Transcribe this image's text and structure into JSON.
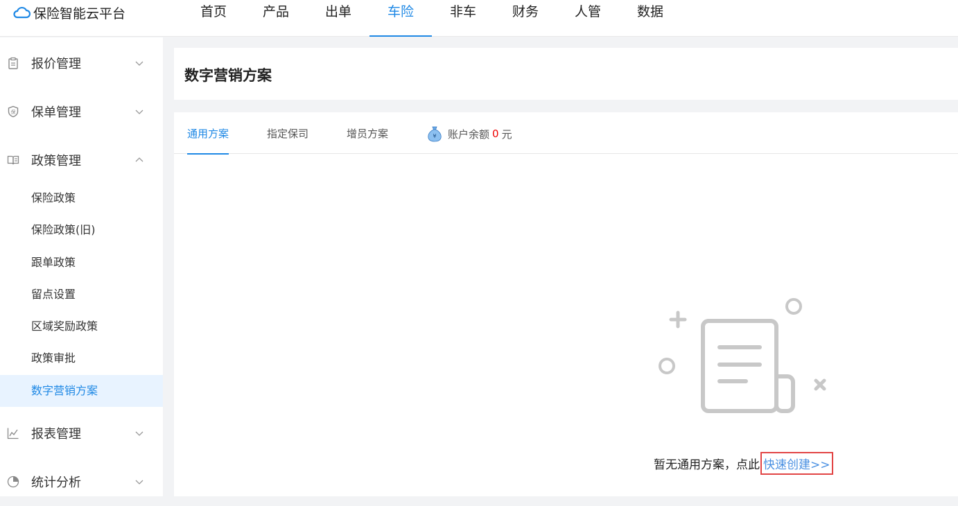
{
  "app": {
    "title": "保险智能云平台",
    "logo_icon": "cloud-icon"
  },
  "nav": {
    "items": [
      {
        "label": "首页",
        "active": false
      },
      {
        "label": "产品",
        "active": false
      },
      {
        "label": "出单",
        "active": false
      },
      {
        "label": "车险",
        "active": true
      },
      {
        "label": "非车",
        "active": false
      },
      {
        "label": "财务",
        "active": false
      },
      {
        "label": "人管",
        "active": false
      },
      {
        "label": "数据",
        "active": false
      }
    ]
  },
  "sidebar": {
    "groups": [
      {
        "label": "报价管理",
        "icon": "clipboard-icon",
        "expanded": false
      },
      {
        "label": "保单管理",
        "icon": "shield-icon",
        "expanded": false
      },
      {
        "label": "政策管理",
        "icon": "book-icon",
        "expanded": true
      },
      {
        "label": "报表管理",
        "icon": "line-chart-icon",
        "expanded": false
      },
      {
        "label": "统计分析",
        "icon": "pie-chart-icon",
        "expanded": false
      }
    ],
    "sub_items": [
      {
        "label": "保险政策",
        "active": false
      },
      {
        "label": "保险政策(旧)",
        "active": false
      },
      {
        "label": "跟单政策",
        "active": false
      },
      {
        "label": "留点设置",
        "active": false
      },
      {
        "label": "区域奖励政策",
        "active": false
      },
      {
        "label": "政策审批",
        "active": false
      },
      {
        "label": "数字营销方案",
        "active": true
      }
    ]
  },
  "page": {
    "title": "数字营销方案"
  },
  "tabs": [
    {
      "label": "通用方案",
      "active": true
    },
    {
      "label": "指定保司",
      "active": false
    },
    {
      "label": "增员方案",
      "active": false
    }
  ],
  "balance": {
    "label": "账户余额",
    "amount": "0",
    "unit": "元",
    "icon": "money-bag-icon"
  },
  "empty": {
    "text": "暂无通用方案，点此",
    "link": "快速创建>>"
  },
  "colors": {
    "accent": "#1e88e5",
    "balance_amount": "#e00000",
    "link": "#4a90e2",
    "highlight_border": "#e24444"
  }
}
